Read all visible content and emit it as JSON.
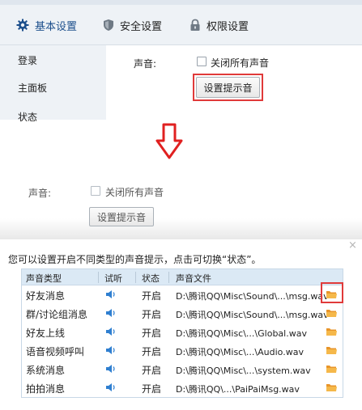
{
  "top_settings": {
    "tabs": [
      {
        "label": "基本设置",
        "icon": "gear-icon",
        "active": true
      },
      {
        "label": "安全设置",
        "icon": "shield-icon",
        "active": false
      },
      {
        "label": "权限设置",
        "icon": "lock-icon",
        "active": false
      }
    ],
    "sidebar": [
      "登录",
      "主面板",
      "状态"
    ],
    "sound_label": "声音:",
    "mute_all_label": "关闭所有声音",
    "set_sound_button": "设置提示音"
  },
  "middle_settings": {
    "sound_label": "声音:",
    "mute_all_label": "关闭所有声音",
    "set_sound_button": "设置提示音"
  },
  "dialog": {
    "hint": "您可以设置开启不同类型的声音提示，点击可切换“状态”。",
    "close_glyph": "×",
    "columns": [
      "声音类型",
      "试听",
      "状态",
      "声音文件"
    ],
    "rows": [
      {
        "type": "好友消息",
        "status": "开启",
        "file": "D:\\腾讯QQ\\Misc\\Sound\\...\\msg.wav"
      },
      {
        "type": "群/讨论组消息",
        "status": "开启",
        "file": "D:\\腾讯QQ\\Misc\\Sound\\...\\msg.wav"
      },
      {
        "type": "好友上线",
        "status": "开启",
        "file": "D:\\腾讯QQ\\Misc\\...\\Global.wav"
      },
      {
        "type": "语音视频呼叫",
        "status": "开启",
        "file": "D:\\腾讯QQ\\Misc\\...\\Audio.wav"
      },
      {
        "type": "系统消息",
        "status": "开启",
        "file": "D:\\腾讯QQ\\Misc\\...\\system.wav"
      },
      {
        "type": "拍拍消息",
        "status": "开启",
        "file": "D:\\腾讯QQ\\...\\PaiPaiMsg.wav"
      }
    ]
  },
  "colors": {
    "highlight_red": "#e03a3a",
    "arrow_red": "#e02020",
    "tab_active": "#1c4f8c",
    "speaker_blue": "#2f7fd0",
    "folder_orange": "#f2a93b"
  }
}
